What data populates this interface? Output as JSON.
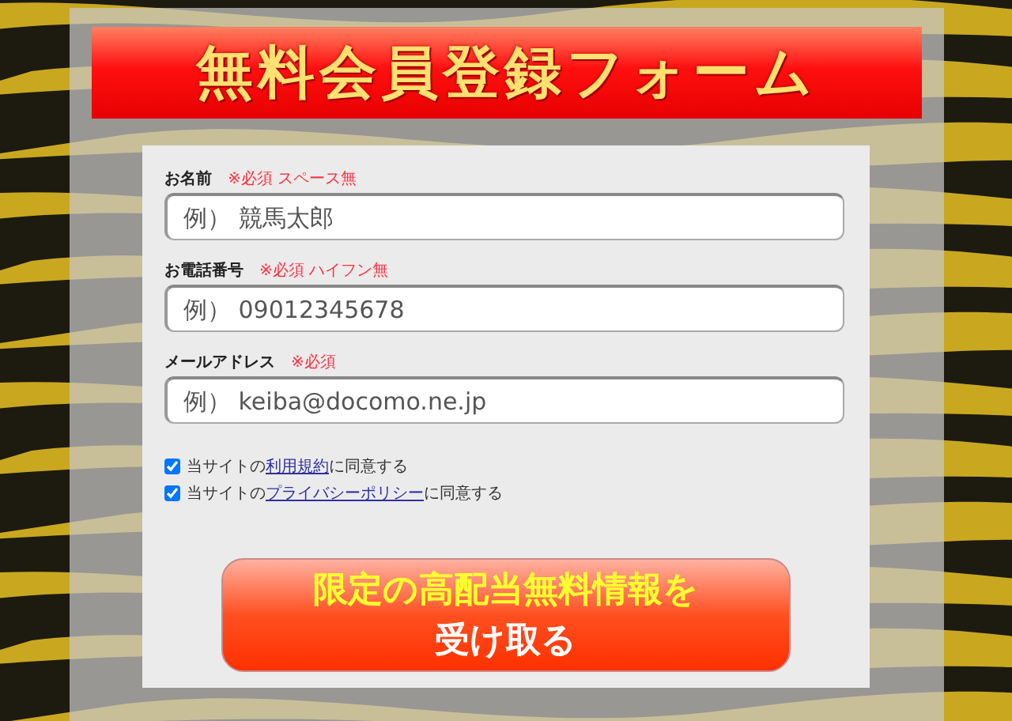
{
  "title": "無料会員登録フォーム",
  "fields": [
    {
      "label": "お名前",
      "note": "※必須 スペース無",
      "placeholder": "例） 競馬太郎"
    },
    {
      "label": "お電話番号",
      "note": "※必須 ハイフン無",
      "placeholder": "例） 09012345678"
    },
    {
      "label": "メールアドレス",
      "note": "※必須",
      "placeholder": "例） keiba@docomo.ne.jp"
    }
  ],
  "agreements": [
    {
      "prefix": "当サイトの",
      "link": "利用規約",
      "suffix": "に同意する",
      "checked": true
    },
    {
      "prefix": "当サイトの",
      "link": "プライバシーポリシー",
      "suffix": "に同意する",
      "checked": true
    }
  ],
  "submit": {
    "line_1": "限定の高配当無料情報を",
    "line_2": "受け取る"
  }
}
